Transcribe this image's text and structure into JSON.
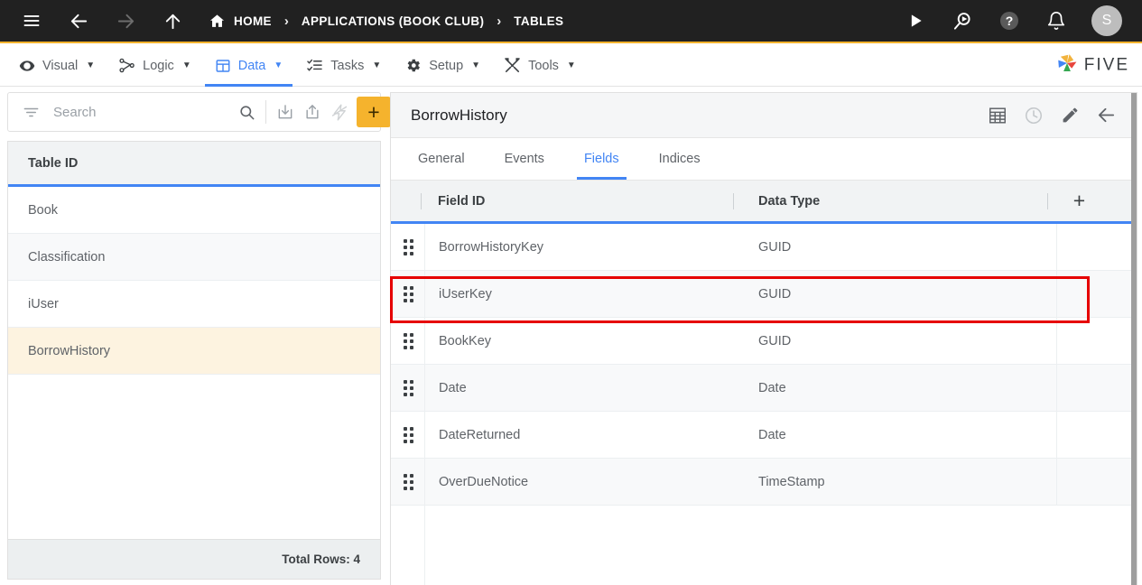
{
  "topbar": {
    "icons": [
      {
        "name": "hamburger-menu-icon",
        "label": "Menu"
      },
      {
        "name": "back-arrow-icon",
        "label": "Back"
      },
      {
        "name": "forward-arrow-icon",
        "label": "Forward"
      },
      {
        "name": "up-arrow-icon",
        "label": "Up"
      }
    ],
    "breadcrumb": [
      {
        "label": "HOME",
        "icon": "home-icon"
      },
      {
        "label": "APPLICATIONS (BOOK CLUB)",
        "icon": ""
      },
      {
        "label": "TABLES",
        "icon": ""
      }
    ],
    "separator": "›",
    "right_icons": [
      {
        "name": "run-play-icon",
        "label": "Run"
      },
      {
        "name": "search-run-icon",
        "label": "Search and Run"
      },
      {
        "name": "help-icon",
        "label": "Help"
      },
      {
        "name": "notifications-bell-icon",
        "label": "Notifications"
      }
    ],
    "avatar_initial": "S"
  },
  "menubar": {
    "items": [
      {
        "label": "Visual",
        "icon": "eye-icon",
        "active": false
      },
      {
        "label": "Logic",
        "icon": "logic-flow-icon",
        "active": false
      },
      {
        "label": "Data",
        "icon": "data-grid-icon",
        "active": true
      },
      {
        "label": "Tasks",
        "icon": "tasks-list-icon",
        "active": false
      },
      {
        "label": "Setup",
        "icon": "gear-icon",
        "active": false
      },
      {
        "label": "Tools",
        "icon": "tools-icon",
        "active": false
      }
    ],
    "caret": "▼",
    "brand": "FIVE"
  },
  "sidebar": {
    "search": {
      "placeholder": "Search",
      "value": ""
    },
    "toolbar_icons": [
      {
        "name": "filter-icon",
        "label": "Filter"
      },
      {
        "name": "search-icon",
        "label": "Search"
      },
      {
        "name": "import-icon",
        "label": "Import"
      },
      {
        "name": "export-icon",
        "label": "Export"
      },
      {
        "name": "quick-action-icon",
        "label": "Quick Action"
      }
    ],
    "add_label": "+",
    "column_header": "Table ID",
    "rows": [
      {
        "label": "Book"
      },
      {
        "label": "Classification"
      },
      {
        "label": "iUser"
      },
      {
        "label": "BorrowHistory"
      }
    ],
    "selected_index": 3,
    "footer": "Total Rows: 4"
  },
  "main": {
    "title": "BorrowHistory",
    "header_icons": [
      {
        "name": "table-grid-icon",
        "label": "Grid View",
        "disabled": false
      },
      {
        "name": "history-clock-icon",
        "label": "History",
        "disabled": true
      },
      {
        "name": "edit-pencil-icon",
        "label": "Edit",
        "disabled": false
      },
      {
        "name": "back-arrow-icon",
        "label": "Back",
        "disabled": false
      }
    ],
    "tabs": [
      {
        "label": "General",
        "active": false
      },
      {
        "label": "Events",
        "active": false
      },
      {
        "label": "Fields",
        "active": true
      },
      {
        "label": "Indices",
        "active": false
      }
    ],
    "grid": {
      "columns": [
        "Field ID",
        "Data Type"
      ],
      "add_column_label": "+",
      "rows": [
        {
          "field_id": "BorrowHistoryKey",
          "data_type": "GUID",
          "highlighted": false
        },
        {
          "field_id": "iUserKey",
          "data_type": "GUID",
          "highlighted": true
        },
        {
          "field_id": "BookKey",
          "data_type": "GUID",
          "highlighted": false
        },
        {
          "field_id": "Date",
          "data_type": "Date",
          "highlighted": false
        },
        {
          "field_id": "DateReturned",
          "data_type": "Date",
          "highlighted": false
        },
        {
          "field_id": "OverDueNotice",
          "data_type": "TimeStamp",
          "highlighted": false
        }
      ]
    }
  },
  "annotation": {
    "color": "#e60000",
    "target": "iUserKey row"
  }
}
